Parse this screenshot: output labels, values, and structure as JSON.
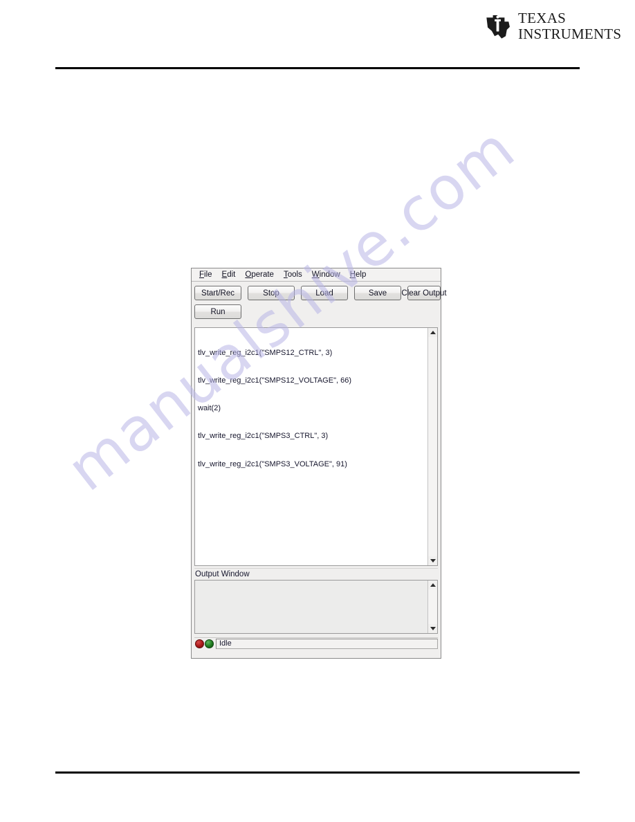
{
  "logo": {
    "line1": "TEXAS",
    "line2": "INSTRUMENTS",
    "icon": "ti-state-logo-icon"
  },
  "watermark": {
    "text": "manualshive.com"
  },
  "app": {
    "menu": [
      {
        "label": "File",
        "mnemonic": "F"
      },
      {
        "label": "Edit",
        "mnemonic": "E"
      },
      {
        "label": "Operate",
        "mnemonic": "O"
      },
      {
        "label": "Tools",
        "mnemonic": "T"
      },
      {
        "label": "Window",
        "mnemonic": "W"
      },
      {
        "label": "Help",
        "mnemonic": "H"
      }
    ],
    "toolbar": {
      "row1": [
        "Start/Rec",
        "Stop",
        "Load",
        "Save",
        "Clear Output"
      ],
      "row2": [
        "Run"
      ]
    },
    "script": {
      "lines": [
        "tlv_write_reg_i2c1(\"SMPS12_CTRL\", 3)",
        "tlv_write_reg_i2c1(\"SMPS12_VOLTAGE\", 66)",
        "wait(2)",
        "tlv_write_reg_i2c1(\"SMPS3_CTRL\", 3)",
        "tlv_write_reg_i2c1(\"SMPS3_VOLTAGE\", 91)"
      ]
    },
    "output": {
      "label": "Output Window",
      "content": ""
    },
    "status": {
      "text": "Idle",
      "led_red_color": "#a81818",
      "led_green_color": "#1f7a1f"
    }
  }
}
